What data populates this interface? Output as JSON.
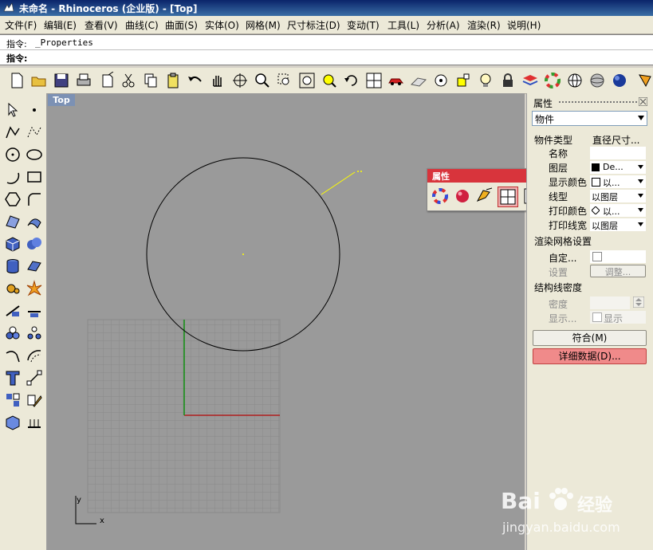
{
  "titlebar": {
    "title": "未命名 - Rhinoceros (企业版) - [Top]"
  },
  "menu": [
    {
      "label": "文件(F)"
    },
    {
      "label": "编辑(E)"
    },
    {
      "label": "查看(V)"
    },
    {
      "label": "曲线(C)"
    },
    {
      "label": "曲面(S)"
    },
    {
      "label": "实体(O)"
    },
    {
      "label": "网格(M)"
    },
    {
      "label": "尺寸标注(D)"
    },
    {
      "label": "变动(T)"
    },
    {
      "label": "工具(L)"
    },
    {
      "label": "分析(A)"
    },
    {
      "label": "渲染(R)"
    },
    {
      "label": "说明(H)"
    }
  ],
  "command": {
    "history_prefix": "指令:",
    "history_text": "_Properties",
    "prompt": "指令:"
  },
  "viewport": {
    "name": "Top",
    "axis_x": "x",
    "axis_y": "y"
  },
  "properties_panel": {
    "title": "属性",
    "selector": "物件",
    "header_left": "物件类型",
    "header_right": "直径尺寸...",
    "rows": [
      {
        "label": "名称",
        "value": ""
      },
      {
        "label": "图层",
        "value": "De..."
      },
      {
        "label": "显示颜色",
        "value": "以..."
      },
      {
        "label": "线型",
        "value": "以图层"
      },
      {
        "label": "打印颜色",
        "value": "以..."
      },
      {
        "label": "打印线宽",
        "value": "以图层"
      }
    ],
    "render_mesh_title": "渲染网格设置",
    "custom_label": "自定...",
    "settings_label": "设置",
    "adjust_button": "调整...",
    "isocurve_title": "结构线密度",
    "density_label": "密度",
    "show_label": "显示...",
    "show_checkbox_label": "显示",
    "match_button": "符合(M)",
    "details_button": "详细数据(D)...",
    "accent_color": "#e86060"
  },
  "float_panel": {
    "title": "属性"
  },
  "watermark": {
    "brand": "Bai",
    "brand2": "经验",
    "site": "jingyan.baidu.com"
  }
}
